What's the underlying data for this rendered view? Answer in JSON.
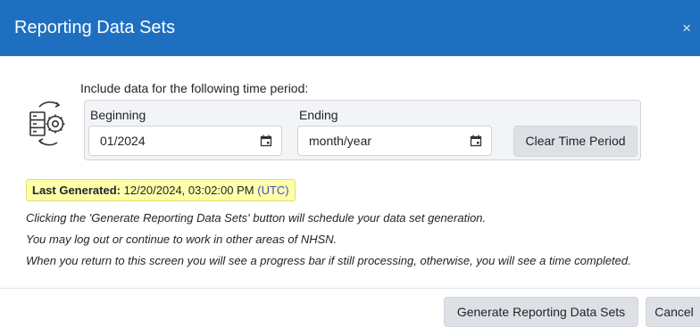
{
  "dialog": {
    "title": "Reporting Data Sets",
    "close_symbol": "×"
  },
  "period": {
    "instruction": "Include data for the following time period:",
    "beginning_label": "Beginning",
    "beginning_value": "01/2024",
    "ending_label": "Ending",
    "ending_placeholder": "month/year",
    "clear_button": "Clear Time Period",
    "icon": "server-gear-icon",
    "calendar_icon": "calendar-icon"
  },
  "last_generated": {
    "label": "Last Generated:",
    "value": "12/20/2024, 03:02:00 PM",
    "timezone": "(UTC)"
  },
  "notes": [
    "Clicking the 'Generate Reporting Data Sets' button will schedule your data set generation.",
    "You may log out or continue to work in other areas of NHSN.",
    "When you return to this screen you will see a progress bar if still processing, otherwise, you will see a time completed."
  ],
  "footer": {
    "generate_button": "Generate Reporting Data Sets",
    "cancel_button": "Cancel"
  },
  "colors": {
    "header": "#1f6fc0",
    "highlight": "#ffffaa",
    "button": "#dde1e6"
  }
}
